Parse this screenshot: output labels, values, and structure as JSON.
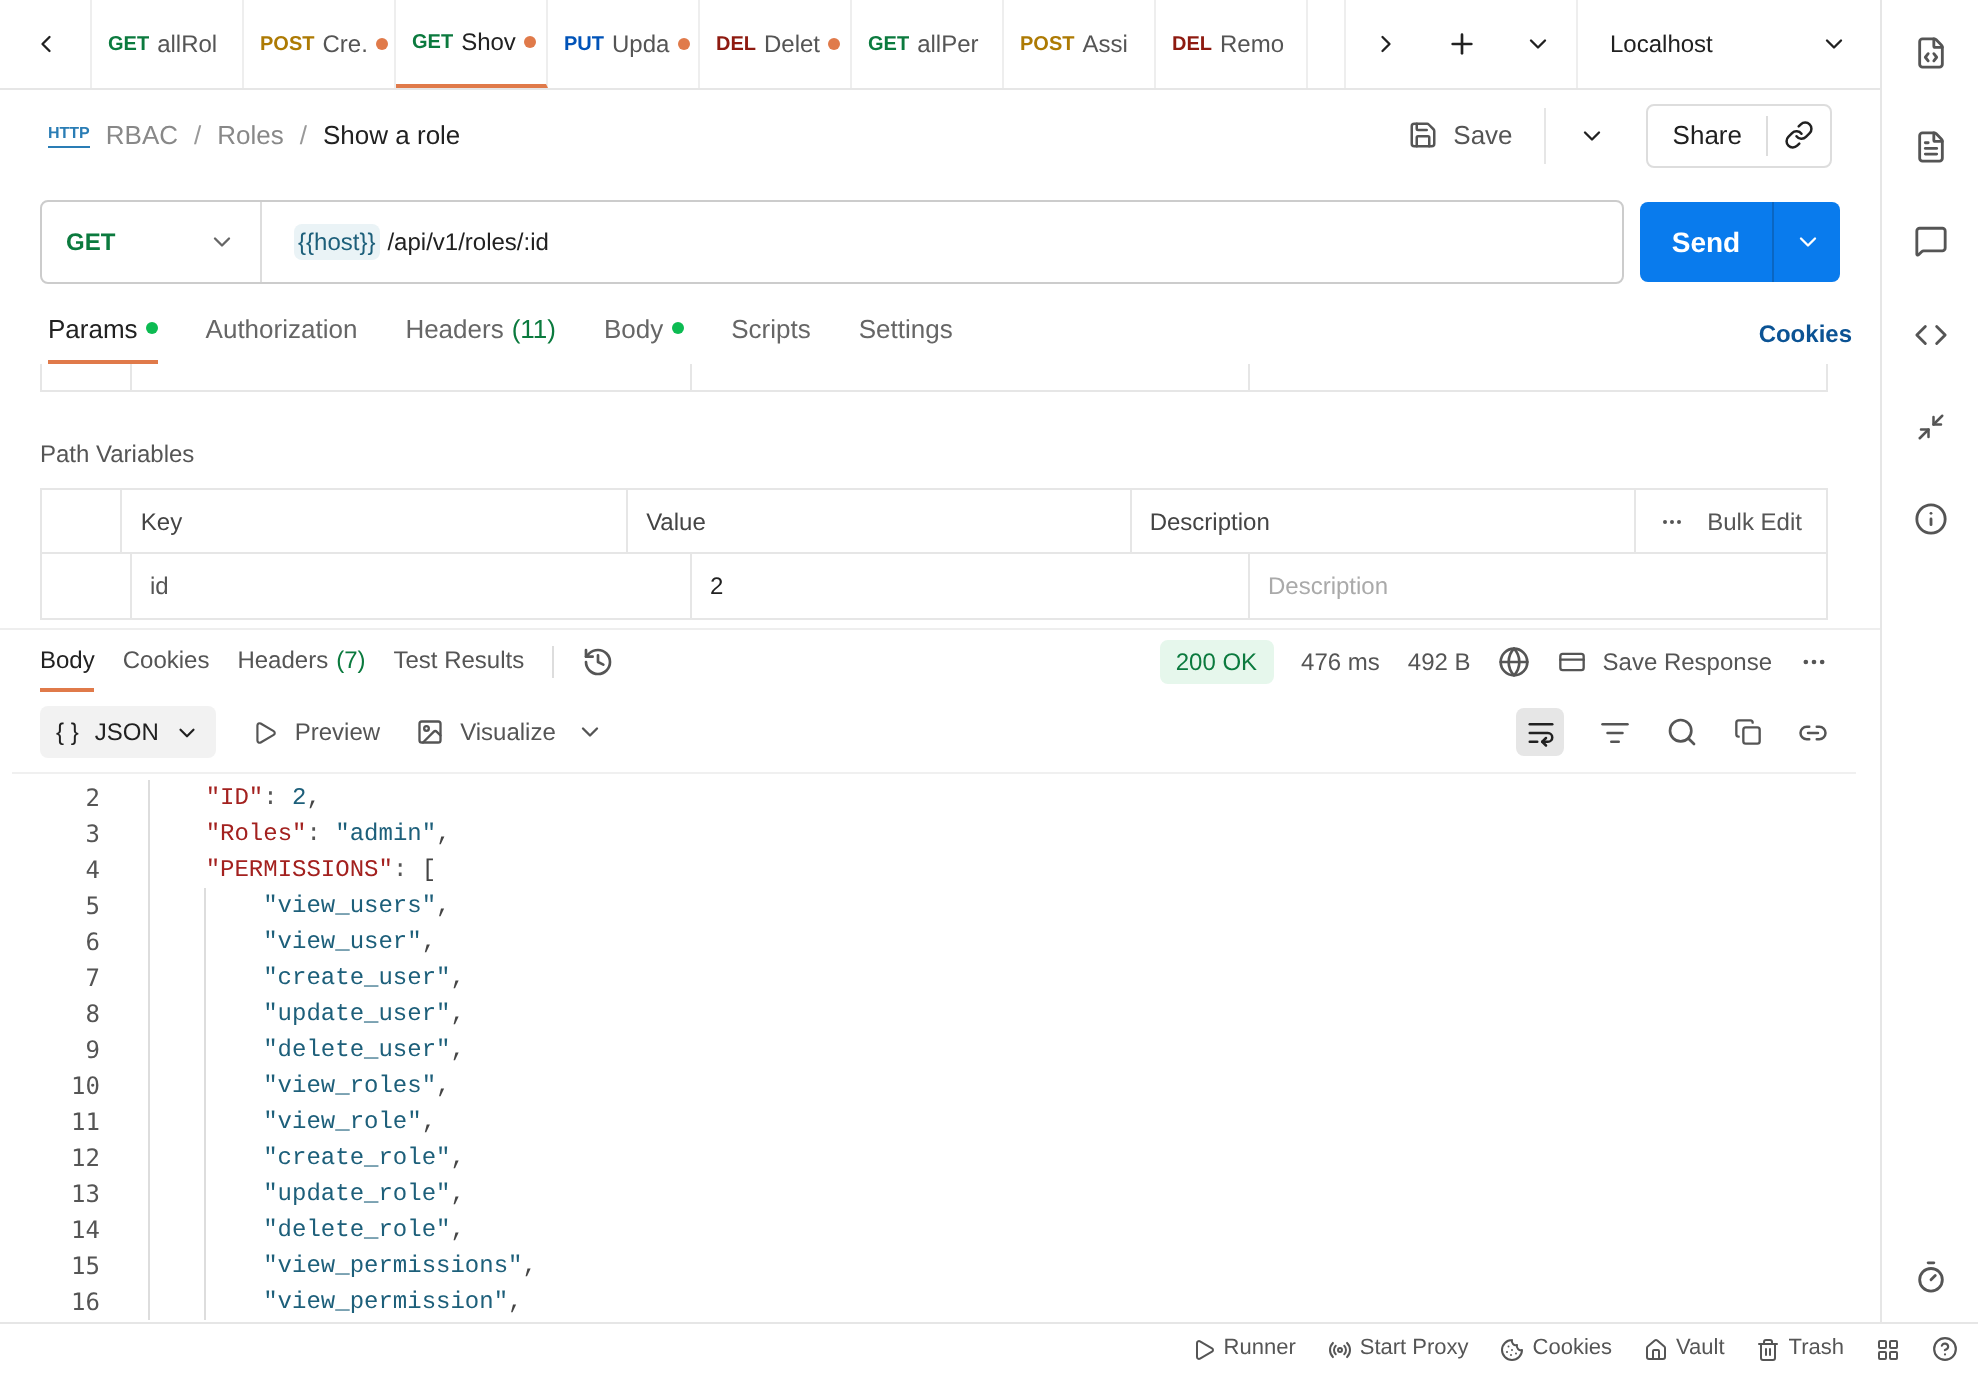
{
  "tabs": [
    {
      "method": "GET",
      "color": "#0b7a3e",
      "name": "allRol",
      "modified": false,
      "selected": false
    },
    {
      "method": "POST",
      "color": "#ad7a03",
      "name": "Cre.",
      "modified": true,
      "selected": false
    },
    {
      "method": "GET",
      "color": "#0b7a3e",
      "name": "Shov",
      "modified": true,
      "selected": true
    },
    {
      "method": "PUT",
      "color": "#0053b8",
      "name": "Upda",
      "modified": true,
      "selected": false
    },
    {
      "method": "DEL",
      "color": "#8e1a10",
      "name": "Delet",
      "modified": true,
      "selected": false
    },
    {
      "method": "GET",
      "color": "#0b7a3e",
      "name": "allPer",
      "modified": false,
      "selected": false
    },
    {
      "method": "POST",
      "color": "#ad7a03",
      "name": "Assi",
      "modified": false,
      "selected": false
    },
    {
      "method": "DEL",
      "color": "#8e1a10",
      "name": "Remo",
      "modified": false,
      "selected": false
    }
  ],
  "environment": "Localhost",
  "breadcrumb": {
    "badge": "HTTP",
    "separator": "/",
    "items": [
      "RBAC",
      "Roles",
      "Show a role"
    ]
  },
  "save": "Save",
  "share": "Share",
  "request": {
    "method": "GET",
    "host": "{{host}}",
    "path": "/api/v1/roles/:id",
    "send": "Send"
  },
  "request_tabs": [
    {
      "label": "Params",
      "dot": true,
      "selected": true
    },
    {
      "label": "Authorization",
      "dot": false,
      "selected": false
    },
    {
      "label": "Headers",
      "count": "(11)",
      "dot": false,
      "selected": false
    },
    {
      "label": "Body",
      "dot": true,
      "selected": false
    },
    {
      "label": "Scripts",
      "dot": false,
      "selected": false
    },
    {
      "label": "Settings",
      "dot": false,
      "selected": false
    }
  ],
  "cookies_link": "Cookies",
  "path_variables": {
    "title": "Path Variables",
    "columns": [
      "Key",
      "Value",
      "Description"
    ],
    "bulk_edit": "Bulk Edit",
    "rows": [
      {
        "key": "id",
        "value": "2",
        "description_placeholder": "Description"
      }
    ]
  },
  "response_tabs": [
    {
      "label": "Body",
      "selected": true
    },
    {
      "label": "Cookies",
      "selected": false
    },
    {
      "label": "Headers",
      "count": "(7)",
      "selected": false
    },
    {
      "label": "Test Results",
      "selected": false
    }
  ],
  "response_status": "200 OK",
  "response_time": "476 ms",
  "response_size": "492 B",
  "save_response": "Save Response",
  "format_icon": "{ }",
  "format": "JSON",
  "preview": "Preview",
  "visualize": "Visualize",
  "wrap_selected": true,
  "code_lines": [
    {
      "number": "2",
      "text": "    \"ID\": 2,"
    },
    {
      "number": "3",
      "text": "    \"Roles\": \"admin\","
    },
    {
      "number": "4",
      "text": "    \"PERMISSIONS\": ["
    },
    {
      "number": "5",
      "text": "        \"view_users\","
    },
    {
      "number": "6",
      "text": "        \"view_user\","
    },
    {
      "number": "7",
      "text": "        \"create_user\","
    },
    {
      "number": "8",
      "text": "        \"update_user\","
    },
    {
      "number": "9",
      "text": "        \"delete_user\","
    },
    {
      "number": "10",
      "text": "        \"view_roles\","
    },
    {
      "number": "11",
      "text": "        \"view_role\","
    },
    {
      "number": "12",
      "text": "        \"create_role\","
    },
    {
      "number": "13",
      "text": "        \"update_role\","
    },
    {
      "number": "14",
      "text": "        \"delete_role\","
    },
    {
      "number": "15",
      "text": "        \"view_permissions\","
    },
    {
      "number": "16",
      "text": "        \"view_permission\","
    }
  ],
  "status_bar": [
    {
      "kind": "runner",
      "label": "Runner"
    },
    {
      "kind": "proxy",
      "label": "Start Proxy"
    },
    {
      "kind": "cookies",
      "label": "Cookies"
    },
    {
      "kind": "vault",
      "label": "Vault"
    },
    {
      "kind": "trash",
      "label": "Trash"
    }
  ]
}
